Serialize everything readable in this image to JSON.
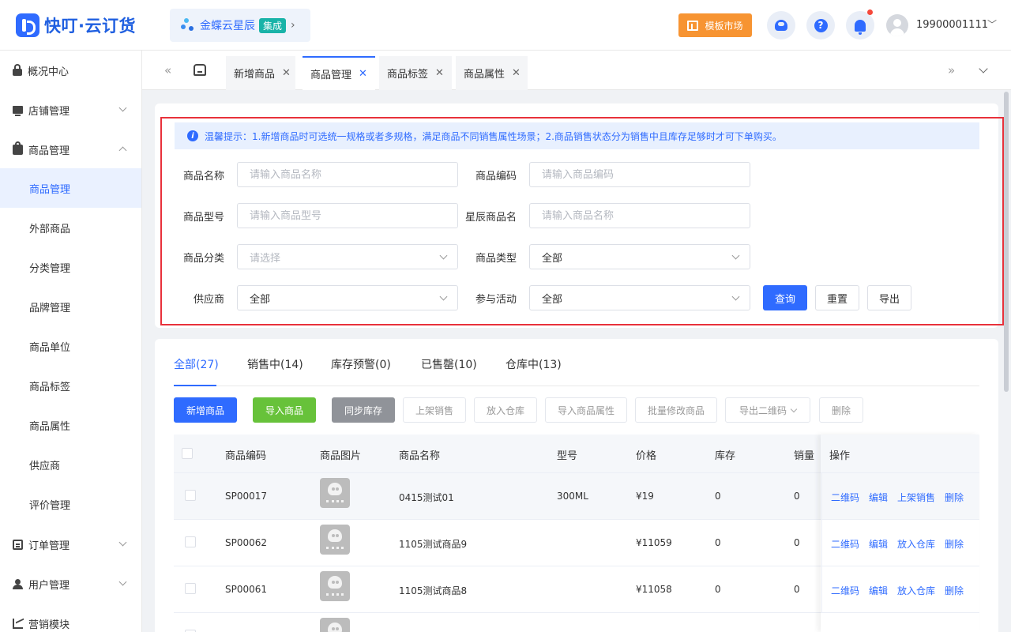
{
  "header": {
    "logo_text": "快叮·云订货",
    "integration": {
      "name": "金蝶云星辰",
      "badge": "集成",
      "arrow": "›"
    },
    "template_market": "模板市场",
    "user": {
      "name": "19900001111",
      "arrow": "﹀"
    },
    "icons": [
      "customer-service-icon",
      "help-icon",
      "bell-icon"
    ]
  },
  "sidebar": {
    "items": [
      {
        "label": "概况中心",
        "icon": "dashboard-lock-icon"
      },
      {
        "label": "店铺管理",
        "icon": "shop-icon",
        "expandable": true
      },
      {
        "label": "商品管理",
        "icon": "bag-icon",
        "expanded": true
      },
      {
        "label": "订单管理",
        "icon": "order-icon",
        "expandable": true
      },
      {
        "label": "用户管理",
        "icon": "user-icon",
        "expandable": true
      },
      {
        "label": "营销模块",
        "icon": "marketing-icon"
      }
    ],
    "sub_items": [
      "商品管理",
      "外部商品",
      "分类管理",
      "品牌管理",
      "商品单位",
      "商品标签",
      "商品属性",
      "供应商",
      "评价管理"
    ],
    "active_sub": "商品管理"
  },
  "tabs": {
    "items": [
      {
        "label": "新增商品",
        "close": "✕"
      },
      {
        "label": "商品管理",
        "close": "✕",
        "active": true
      },
      {
        "label": "商品标签",
        "close": "✕"
      },
      {
        "label": "商品属性",
        "close": "✕"
      }
    ],
    "nav_left": "«",
    "nav_right": "»"
  },
  "filter": {
    "tip_icon": "i",
    "tip": "温馨提示：1.新增商品时可选统一规格或者多规格，满足商品不同销售属性场景；2.商品销售状态分为销售中且库存足够时才可下单购买。",
    "fields": {
      "product_name": {
        "label": "商品名称",
        "placeholder": "请输入商品名称"
      },
      "product_code": {
        "label": "商品编码",
        "placeholder": "请输入商品编码"
      },
      "product_model": {
        "label": "商品型号",
        "placeholder": "请输入商品型号"
      },
      "xc_product_name": {
        "label": "星辰商品名",
        "placeholder": "请输入商品名称"
      },
      "category": {
        "label": "商品分类",
        "placeholder": "请选择"
      },
      "product_type": {
        "label": "商品类型",
        "value": "全部"
      },
      "supplier": {
        "label": "供应商",
        "value": "全部"
      },
      "activity": {
        "label": "参与活动",
        "value": "全部"
      }
    },
    "buttons": {
      "query": "查询",
      "reset": "重置",
      "export": "导出"
    }
  },
  "status_tabs": [
    {
      "label": "全部(27)",
      "active": true
    },
    {
      "label": "销售中(14)"
    },
    {
      "label": "库存预警(0)"
    },
    {
      "label": "已售罄(10)"
    },
    {
      "label": "仓库中(13)"
    }
  ],
  "actions": {
    "add": "新增商品",
    "import": "导入商品",
    "sync_stock": "同步库存",
    "on_sale": "上架销售",
    "to_warehouse": "放入仓库",
    "import_attr": "导入商品属性",
    "batch_edit": "批量修改商品",
    "export_qr": "导出二维码",
    "delete": "删除"
  },
  "table": {
    "columns": [
      "商品编码",
      "商品图片",
      "商品名称",
      "型号",
      "价格",
      "库存",
      "销量",
      "操作"
    ],
    "rows": [
      {
        "code": "SP00017",
        "name": "0415测试01",
        "model": "300ML",
        "price": "¥19",
        "stock": "0",
        "sales": "0",
        "ops": [
          "二维码",
          "编辑",
          "上架销售",
          "删除"
        ]
      },
      {
        "code": "SP00062",
        "name": "1105测试商品9",
        "model": "",
        "price": "¥11059",
        "stock": "0",
        "sales": "0",
        "ops": [
          "二维码",
          "编辑",
          "放入仓库",
          "删除"
        ]
      },
      {
        "code": "SP00061",
        "name": "1105测试商品8",
        "model": "",
        "price": "¥11058",
        "stock": "0",
        "sales": "0",
        "ops": [
          "二维码",
          "编辑",
          "放入仓库",
          "删除"
        ]
      }
    ]
  },
  "colors": {
    "primary": "#2f6bff",
    "success": "#67c23a",
    "warning": "#f79432",
    "danger": "#e8313b"
  }
}
